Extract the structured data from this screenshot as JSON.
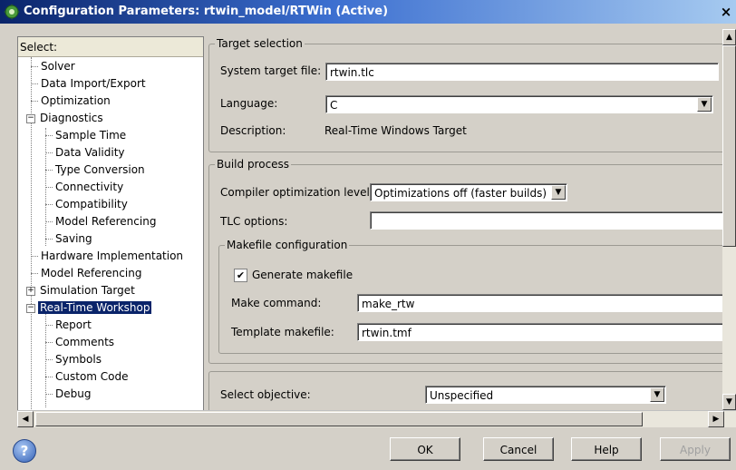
{
  "window": {
    "title": "Configuration Parameters: rtwin_model/RTWin (Active)",
    "close_glyph": "×",
    "app_icon": "simulink-gear-icon"
  },
  "tree": {
    "header": "Select:",
    "items": [
      {
        "label": "Solver"
      },
      {
        "label": "Data Import/Export"
      },
      {
        "label": "Optimization"
      },
      {
        "label": "Diagnostics"
      },
      {
        "label": "Sample Time"
      },
      {
        "label": "Data Validity"
      },
      {
        "label": "Type Conversion"
      },
      {
        "label": "Connectivity"
      },
      {
        "label": "Compatibility"
      },
      {
        "label": "Model Referencing"
      },
      {
        "label": "Saving"
      },
      {
        "label": "Hardware Implementation"
      },
      {
        "label": "Model Referencing"
      },
      {
        "label": "Simulation Target"
      },
      {
        "label": "Real-Time Workshop"
      },
      {
        "label": "Report"
      },
      {
        "label": "Comments"
      },
      {
        "label": "Symbols"
      },
      {
        "label": "Custom Code"
      },
      {
        "label": "Debug"
      }
    ],
    "selected_label": "Real-Time Workshop"
  },
  "target_selection": {
    "legend": "Target selection",
    "system_target_file_label": "System target file:",
    "system_target_file_value": "rtwin.tlc",
    "language_label": "Language:",
    "language_value": "C",
    "description_label": "Description:",
    "description_value": "Real-Time Windows Target"
  },
  "build_process": {
    "legend": "Build process",
    "compiler_opt_label": "Compiler optimization level:",
    "compiler_opt_value": "Optimizations off (faster builds)",
    "tlc_options_label": "TLC options:",
    "tlc_options_value": "",
    "makefile": {
      "legend": "Makefile configuration",
      "generate_makefile_label": "Generate makefile",
      "generate_makefile_checked": "✔",
      "make_command_label": "Make command:",
      "make_command_value": "make_rtw",
      "template_makefile_label": "Template makefile:",
      "template_makefile_value": "rtwin.tmf"
    }
  },
  "objective": {
    "label": "Select objective:",
    "value": "Unspecified"
  },
  "buttons": {
    "ok": "OK",
    "cancel": "Cancel",
    "help": "Help",
    "apply": "Apply"
  },
  "help_icon_glyph": "?",
  "scroll_glyphs": {
    "up": "▲",
    "down": "▼",
    "left": "◀",
    "right": "▶"
  }
}
